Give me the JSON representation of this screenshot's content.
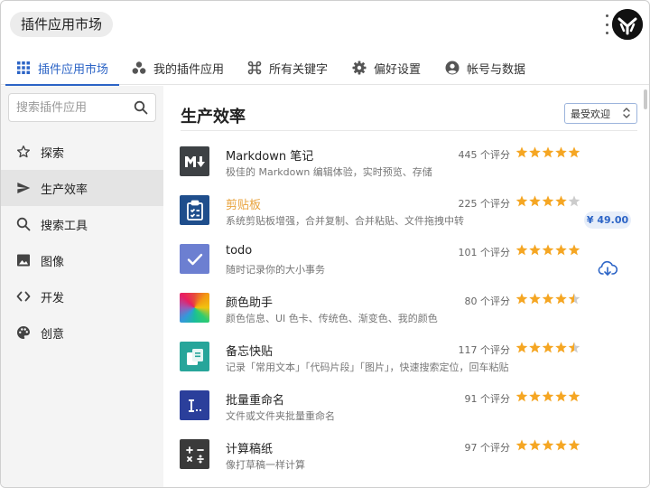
{
  "app": {
    "title": "插件应用市场"
  },
  "topnav": {
    "tabs": [
      {
        "label": "插件应用市场",
        "icon": "grid-icon",
        "active": true
      },
      {
        "label": "我的插件应用",
        "icon": "plugins-icon",
        "active": false
      },
      {
        "label": "所有关键字",
        "icon": "command-icon",
        "active": false
      },
      {
        "label": "偏好设置",
        "icon": "gear-icon",
        "active": false
      },
      {
        "label": "帐号与数据",
        "icon": "account-icon",
        "active": false
      }
    ]
  },
  "sidebar": {
    "search_placeholder": "搜索插件应用",
    "items": [
      {
        "label": "探索",
        "icon": "star-outline-icon",
        "active": false
      },
      {
        "label": "生产效率",
        "icon": "send-icon",
        "active": true
      },
      {
        "label": "搜索工具",
        "icon": "search-icon",
        "active": false
      },
      {
        "label": "图像",
        "icon": "image-icon",
        "active": false
      },
      {
        "label": "开发",
        "icon": "code-icon",
        "active": false
      },
      {
        "label": "创意",
        "icon": "palette-icon",
        "active": false
      }
    ]
  },
  "main": {
    "title": "生产效率",
    "sort_label": "最受欢迎",
    "apps": [
      {
        "name": "Markdown 笔记",
        "desc": "极佳的 Markdown 编辑体验，实时预览、存储",
        "ratings": "445 个评分",
        "stars": 5.0,
        "icon": "markdown-icon"
      },
      {
        "name": "剪贴板",
        "desc": "系统剪贴板增强，合并复制、合并粘贴、文件拖拽中转",
        "ratings": "225 个评分",
        "stars": 4.0,
        "price": "¥ 49.00",
        "icon": "clipboard-icon"
      },
      {
        "name": "todo",
        "desc": "随时记录你的大小事务",
        "ratings": "101 个评分",
        "stars": 5.0,
        "icon": "checkmark-icon",
        "action": "cloud-download-icon"
      },
      {
        "name": "颜色助手",
        "desc": "颜色信息、UI 色卡、传统色、渐变色、我的颜色",
        "ratings": "80 个评分",
        "stars": 4.5,
        "icon": "color-wheel-icon"
      },
      {
        "name": "备忘快贴",
        "desc": "记录「常用文本」「代码片段」「图片」，快速搜索定位，回车粘贴",
        "ratings": "117 个评分",
        "stars": 4.5,
        "icon": "memo-icon"
      },
      {
        "name": "批量重命名",
        "desc": "文件或文件夹批量重命名",
        "ratings": "91 个评分",
        "stars": 5.0,
        "icon": "rename-icon"
      },
      {
        "name": "计算稿纸",
        "desc": "像打草稿一样计算",
        "ratings": "97 个评分",
        "stars": 5.0,
        "icon": "calculator-icon"
      }
    ]
  },
  "colors": {
    "accent": "#2c64c6",
    "star": "#f5a623",
    "paid_name": "#e8a33d",
    "sidebar_bg": "#f4f4f4"
  }
}
